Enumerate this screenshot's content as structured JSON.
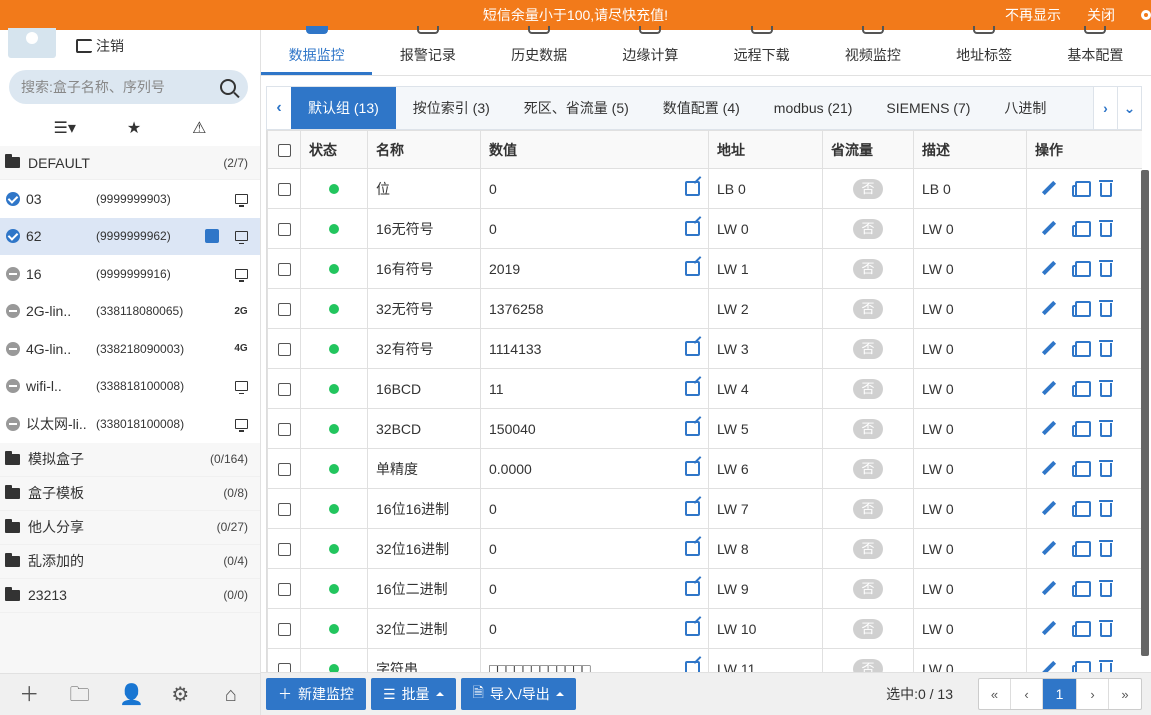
{
  "notice": {
    "message": "短信余量小于100,请尽快充值!",
    "dismiss": "不再显示",
    "close": "关闭"
  },
  "sidebar": {
    "logout": "注销",
    "search_placeholder": "搜索:盒子名称、序列号",
    "filters": [
      "list",
      "star",
      "warning"
    ],
    "groups_top": {
      "name": "DEFAULT",
      "count": "(2/7)"
    },
    "devices": [
      {
        "name": "03",
        "serial": "(9999999903)",
        "status": "online",
        "net": "monitor"
      },
      {
        "name": "62",
        "serial": "(9999999962)",
        "status": "online",
        "net": "monitor",
        "shared": true,
        "active": true
      },
      {
        "name": "16",
        "serial": "(9999999916)",
        "status": "offline",
        "net": "monitor"
      },
      {
        "name": "2G-lin..",
        "serial": "(338118080065)",
        "status": "offline",
        "net": "2G"
      },
      {
        "name": "4G-lin..",
        "serial": "(338218090003)",
        "status": "offline",
        "net": "4G"
      },
      {
        "name": "wifi-l..",
        "serial": "(338818100008)",
        "status": "offline",
        "net": "monitor"
      },
      {
        "name": "以太网-li..",
        "serial": "(338018100008)",
        "status": "offline",
        "net": "monitor"
      }
    ],
    "groups": [
      {
        "name": "模拟盒子",
        "count": "(0/164)"
      },
      {
        "name": "盒子模板",
        "count": "(0/8)"
      },
      {
        "name": "他人分享",
        "count": "(0/27)"
      },
      {
        "name": "乱添加的",
        "count": "(0/4)"
      },
      {
        "name": "23213",
        "count": "(0/0)"
      }
    ]
  },
  "top_tabs": [
    "数据监控",
    "报警记录",
    "历史数据",
    "边缘计算",
    "远程下载",
    "视频监控",
    "地址标签",
    "基本配置"
  ],
  "group_tabs": [
    "默认组 (13)",
    "按位索引 (3)",
    "死区、省流量 (5)",
    "数值配置 (4)",
    "modbus (21)",
    "SIEMENS (7)",
    "八进制"
  ],
  "table": {
    "headers": [
      "状态",
      "名称",
      "数值",
      "地址",
      "省流量",
      "描述",
      "操作"
    ],
    "rows": [
      {
        "name": "位",
        "value": "0",
        "addr": "LB 0",
        "save": "否",
        "desc": "LB 0",
        "editable": true
      },
      {
        "name": "16无符号",
        "value": "0",
        "addr": "LW 0",
        "save": "否",
        "desc": "LW 0",
        "editable": true
      },
      {
        "name": "16有符号",
        "value": "2019",
        "addr": "LW 1",
        "save": "否",
        "desc": "LW 0",
        "editable": true
      },
      {
        "name": "32无符号",
        "value": "1376258",
        "addr": "LW 2",
        "save": "否",
        "desc": "LW 0",
        "editable": false
      },
      {
        "name": "32有符号",
        "value": "1114133",
        "addr": "LW 3",
        "save": "否",
        "desc": "LW 0",
        "editable": true
      },
      {
        "name": "16BCD",
        "value": "11",
        "addr": "LW 4",
        "save": "否",
        "desc": "LW 0",
        "editable": true
      },
      {
        "name": "32BCD",
        "value": "150040",
        "addr": "LW 5",
        "save": "否",
        "desc": "LW 0",
        "editable": true
      },
      {
        "name": "单精度",
        "value": "0.0000",
        "addr": "LW 6",
        "save": "否",
        "desc": "LW 0",
        "editable": true
      },
      {
        "name": "16位16进制",
        "value": "0",
        "addr": "LW 7",
        "save": "否",
        "desc": "LW 0",
        "editable": true
      },
      {
        "name": "32位16进制",
        "value": "0",
        "addr": "LW 8",
        "save": "否",
        "desc": "LW 0",
        "editable": true
      },
      {
        "name": "16位二进制",
        "value": "0",
        "addr": "LW 9",
        "save": "否",
        "desc": "LW 0",
        "editable": true
      },
      {
        "name": "32位二进制",
        "value": "0",
        "addr": "LW 10",
        "save": "否",
        "desc": "LW 0",
        "editable": true
      },
      {
        "name": "字符串",
        "value": "□□□□□□□□□□□□",
        "addr": "LW 11",
        "save": "否",
        "desc": "LW 0",
        "editable": true
      }
    ]
  },
  "toolbar": {
    "new": "新建监控",
    "batch": "批量",
    "io": "导入/导出",
    "selected": "选中:0 / 13",
    "pager": [
      "«",
      "‹",
      "1",
      "›",
      "»"
    ]
  },
  "colors": {
    "accent": "#2f76c8",
    "notice": "#f27a1a",
    "online": "#22c55e"
  }
}
